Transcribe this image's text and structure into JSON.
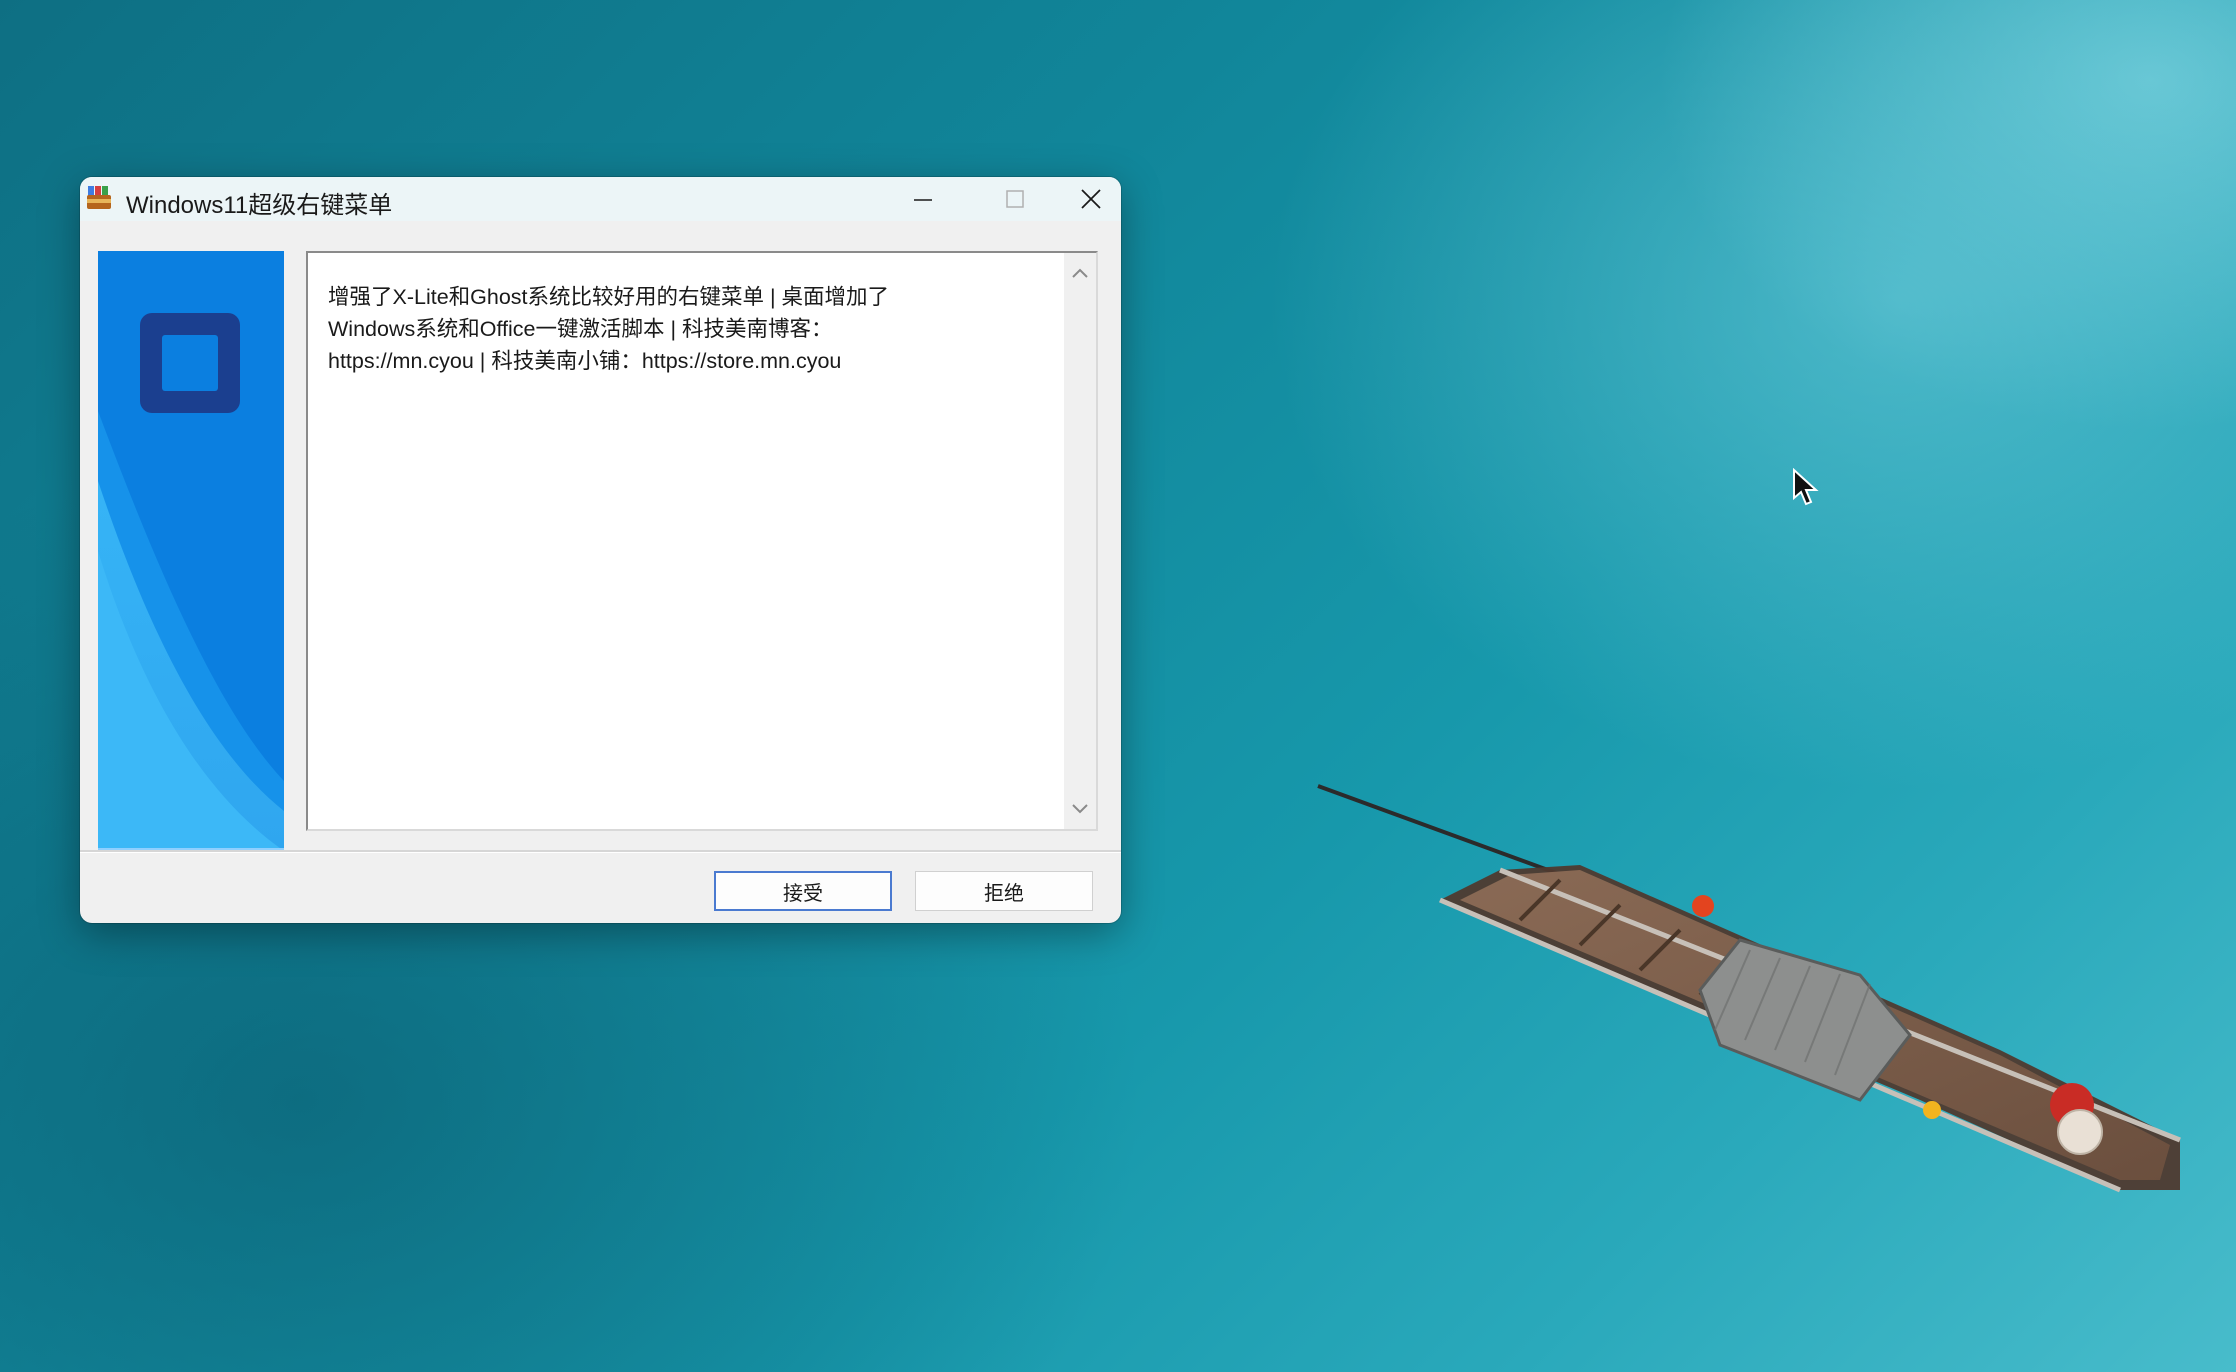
{
  "window": {
    "title": "Windows11超级右键菜单",
    "icons": {
      "app": "winrar-books-icon",
      "minimize": "minimize-icon",
      "maximize": "maximize-icon",
      "close": "close-icon"
    }
  },
  "content": {
    "license_text": "增强了X-Lite和Ghost系统比较好用的右键菜单 | 桌面增加了\nWindows系统和Office一键激活脚本 | 科技美南博客：\nhttps://mn.cyou | 科技美南小铺：https://store.mn.cyou"
  },
  "buttons": {
    "accept_label": "接受",
    "reject_label": "拒绝"
  },
  "colors": {
    "accent": "#0a8ee8",
    "logo_dark": "#1b3f8f",
    "wallpaper": "#1798ab"
  }
}
